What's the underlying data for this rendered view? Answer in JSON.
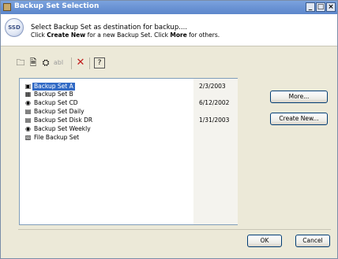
{
  "window": {
    "title": "Backup Set Selection",
    "controls": {
      "minimize": "_",
      "maximize": "□",
      "close": "×"
    }
  },
  "header": {
    "icon_name": "backup-set-icon",
    "icon_text": "SSD",
    "line1": "Select Backup Set as destination for backup....",
    "line2_prefix": "Click ",
    "line2_create": "Create New",
    "line2_mid": " for a new Backup Set. Click ",
    "line2_more": "More",
    "line2_suffix": " for others."
  },
  "toolbar": {
    "items": [
      {
        "name": "new-icon",
        "glyph": "🗀"
      },
      {
        "name": "properties-icon",
        "glyph": "🗎"
      },
      {
        "name": "run-icon",
        "glyph": "⛭"
      },
      {
        "name": "rename-icon",
        "glyph": "abl"
      },
      {
        "name": "delete-icon",
        "glyph": "✕"
      },
      {
        "name": "help-icon",
        "glyph": "?"
      }
    ]
  },
  "backup_sets": [
    {
      "name": "Backup Set A",
      "date": "2/3/2003",
      "icon": "backup-set-icon",
      "glyph": "▣",
      "selected": true
    },
    {
      "name": "Backup Set B",
      "date": "",
      "icon": "network-backup-icon",
      "glyph": "▦",
      "selected": false
    },
    {
      "name": "Backup Set CD",
      "date": "6/12/2002",
      "icon": "cd-icon",
      "glyph": "◉",
      "selected": false
    },
    {
      "name": "Backup Set Daily",
      "date": "",
      "icon": "disk-icon",
      "glyph": "▤",
      "selected": false
    },
    {
      "name": "Backup Set Disk DR",
      "date": "1/31/2003",
      "icon": "disk-icon",
      "glyph": "▤",
      "selected": false
    },
    {
      "name": "Backup Set Weekly",
      "date": "",
      "icon": "cd-icon",
      "glyph": "◉",
      "selected": false
    },
    {
      "name": "File Backup Set",
      "date": "",
      "icon": "file-backup-icon",
      "glyph": "▧",
      "selected": false
    }
  ],
  "buttons": {
    "more": "More...",
    "create_new": "Create New...",
    "ok": "OK",
    "cancel": "Cancel"
  },
  "colors": {
    "title_bar": "#6d96d6",
    "selection": "#316ac5",
    "dialog_bg": "#ece9d8"
  }
}
